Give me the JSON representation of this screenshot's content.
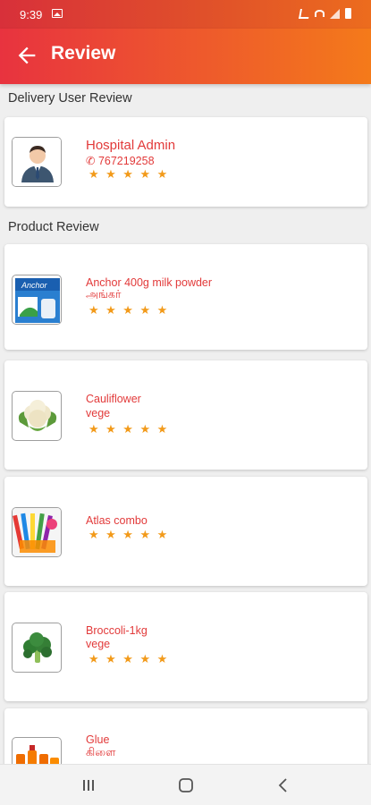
{
  "status_bar": {
    "time": "9:39"
  },
  "app_bar": {
    "title": "Review"
  },
  "sections": {
    "delivery_title": "Delivery User Review",
    "product_title": "Product Review"
  },
  "delivery_user": {
    "name": "Hospital Admin",
    "phone": "767219258",
    "stars": "★★★★★",
    "rating": 5
  },
  "products": [
    {
      "name": "Anchor 400g milk powder",
      "sub": "அங்கர்",
      "stars": "★★★★★",
      "rating": 5
    },
    {
      "name": "Cauliflower",
      "sub": "vege",
      "stars": "★★★★★",
      "rating": 5
    },
    {
      "name": "Atlas combo",
      "sub": "",
      "stars": "★★★★★",
      "rating": 5
    },
    {
      "name": "Broccoli-1kg",
      "sub": "vege",
      "stars": "★★★★★",
      "rating": 5
    },
    {
      "name": "Glue",
      "sub": "கிளை",
      "stars": "",
      "rating": null
    }
  ],
  "colors": {
    "accent_start": "#e8333f",
    "accent_end": "#f47a1a",
    "text_red": "#e23a3a",
    "star": "#f29a1a"
  }
}
